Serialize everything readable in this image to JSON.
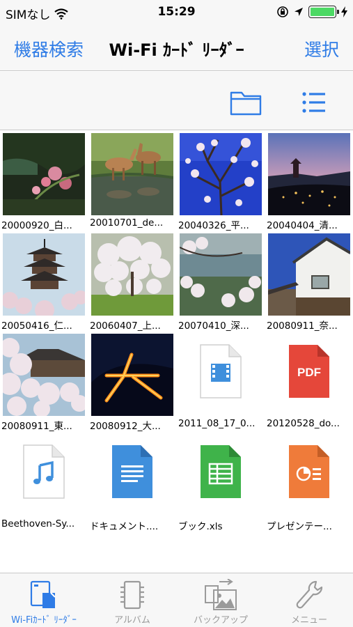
{
  "status_bar": {
    "carrier": "SIMなし",
    "time": "15:29"
  },
  "nav": {
    "left_button": "機器検索",
    "title": "Wi-Fi ｶｰﾄﾞ ﾘｰﾀﾞｰ",
    "right_button": "選択"
  },
  "toolbar": {
    "folder_icon": "folder-icon",
    "list_icon": "list-icon"
  },
  "files": [
    {
      "name": "20000920_白...",
      "kind": "photo"
    },
    {
      "name": "20010701_de...",
      "kind": "photo"
    },
    {
      "name": "20040326_平...",
      "kind": "photo"
    },
    {
      "name": "20040404_清...",
      "kind": "photo"
    },
    {
      "name": "20050416_仁...",
      "kind": "photo"
    },
    {
      "name": "20060407_上...",
      "kind": "photo"
    },
    {
      "name": "20070410_深...",
      "kind": "photo"
    },
    {
      "name": "20080911_奈...",
      "kind": "photo"
    },
    {
      "name": "20080911_東...",
      "kind": "photo"
    },
    {
      "name": "20080912_大...",
      "kind": "photo"
    },
    {
      "name": "2011_08_17_0...",
      "kind": "video",
      "icon": "video-file-icon"
    },
    {
      "name": "20120528_do...",
      "kind": "pdf",
      "icon": "pdf-file-icon",
      "badge": "PDF"
    },
    {
      "name": "Beethoven-Sy...",
      "kind": "audio",
      "icon": "music-file-icon"
    },
    {
      "name": "ドキュメント....",
      "kind": "doc",
      "icon": "document-file-icon"
    },
    {
      "name": "ブック.xls",
      "kind": "sheet",
      "icon": "spreadsheet-file-icon"
    },
    {
      "name": "プレゼンテー...",
      "kind": "slides",
      "icon": "presentation-file-icon"
    }
  ],
  "tabs": [
    {
      "label": "Wi-Fiｶｰﾄﾞ ﾘｰﾀﾞｰ",
      "icon": "card-reader-icon",
      "active": true
    },
    {
      "label": "アルバム",
      "icon": "album-icon",
      "active": false
    },
    {
      "label": "バックアップ",
      "icon": "backup-icon",
      "active": false
    },
    {
      "label": "メニュー",
      "icon": "wrench-icon",
      "active": false
    }
  ],
  "colors": {
    "accent": "#2f7ce6",
    "pdf": "#e5473a",
    "doc": "#3f8fdc",
    "sheet": "#3fb34a",
    "slides": "#ef7b3a"
  }
}
